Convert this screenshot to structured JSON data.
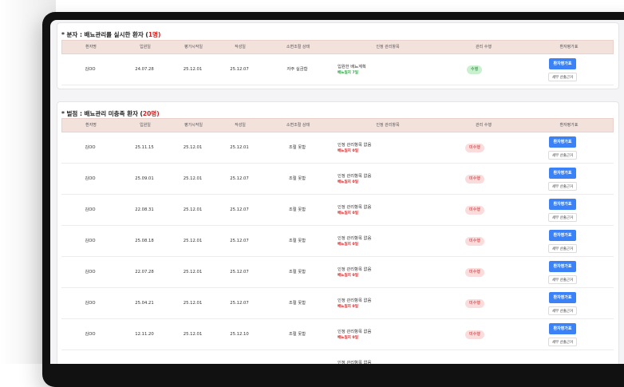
{
  "section1": {
    "title_prefix": "* 분자 : 배뇨관리를 실시한 환자 (",
    "count": "1명",
    "title_suffix": ")",
    "headers": [
      "환자명",
      "입원일",
      "평가시작일",
      "작성일",
      "소변조절 상태",
      "인정 관리항목",
      "관리 수행",
      "환자평가표"
    ],
    "rows": [
      {
        "name": "김OO",
        "admit": "24.07.28",
        "start": "25.12.01",
        "written": "25.12.07",
        "status": "자주 실금함",
        "item": "입원한 배뇨계획",
        "days": "배뇨일지 7일",
        "result": "수행",
        "eval_btn": "환자평가표",
        "detail_btn": "세부 산출근거"
      }
    ]
  },
  "section2": {
    "title_prefix": "* 벌점 : 배뇨관리 미충족 환자 (",
    "count": "20명",
    "title_suffix": ")",
    "headers": [
      "환자명",
      "입원일",
      "평가시작일",
      "작성일",
      "소변조절 상태",
      "인정 관리항목",
      "관리 수행",
      "환자평가표"
    ],
    "rows": [
      {
        "name": "김OO",
        "admit": "25.11.15",
        "start": "25.12.01",
        "written": "25.12.01",
        "status": "조절 못함",
        "item": "인정 관리항목 없음",
        "days": "배뇨일지 0일",
        "result": "미수행",
        "eval_btn": "환자평가표",
        "detail_btn": "세부 산출근거"
      },
      {
        "name": "김OO",
        "admit": "25.09.01",
        "start": "25.12.01",
        "written": "25.12.07",
        "status": "조절 못함",
        "item": "인정 관리항목 없음",
        "days": "배뇨일지 0일",
        "result": "미수행",
        "eval_btn": "환자평가표",
        "detail_btn": "세부 산출근거"
      },
      {
        "name": "김OO",
        "admit": "22.08.31",
        "start": "25.12.01",
        "written": "25.12.07",
        "status": "조절 못함",
        "item": "인정 관리항목 없음",
        "days": "배뇨일지 0일",
        "result": "미수행",
        "eval_btn": "환자평가표",
        "detail_btn": "세부 산출근거"
      },
      {
        "name": "김OO",
        "admit": "25.08.18",
        "start": "25.12.01",
        "written": "25.12.07",
        "status": "조절 못함",
        "item": "인정 관리항목 없음",
        "days": "배뇨일지 0일",
        "result": "미수행",
        "eval_btn": "환자평가표",
        "detail_btn": "세부 산출근거"
      },
      {
        "name": "김OO",
        "admit": "22.07.28",
        "start": "25.12.01",
        "written": "25.12.07",
        "status": "조절 못함",
        "item": "인정 관리항목 없음",
        "days": "배뇨일지 0일",
        "result": "미수행",
        "eval_btn": "환자평가표",
        "detail_btn": "세부 산출근거"
      },
      {
        "name": "김OO",
        "admit": "25.04.21",
        "start": "25.12.01",
        "written": "25.12.07",
        "status": "조절 못함",
        "item": "인정 관리항목 없음",
        "days": "배뇨일지 0일",
        "result": "미수행",
        "eval_btn": "환자평가표",
        "detail_btn": "세부 산출근거"
      },
      {
        "name": "김OO",
        "admit": "12.11.20",
        "start": "25.12.01",
        "written": "25.12.10",
        "status": "조절 못함",
        "item": "인정 관리항목 없음",
        "days": "배뇨일지 0일",
        "result": "미수행",
        "eval_btn": "환자평가표",
        "detail_btn": "세부 산출근거"
      },
      {
        "name": "",
        "admit": "",
        "start": "",
        "written": "",
        "status": "",
        "item": "인정 관리항목 없음",
        "days": "",
        "result": "",
        "eval_btn": "",
        "detail_btn": ""
      }
    ]
  },
  "colors": {
    "accent_blue": "#3b82f6",
    "header_bg": "#f3e1dc",
    "count_red": "#d21f1f",
    "badge_ok_bg": "#c9f0cf",
    "badge_no_bg": "#fadcdc"
  }
}
